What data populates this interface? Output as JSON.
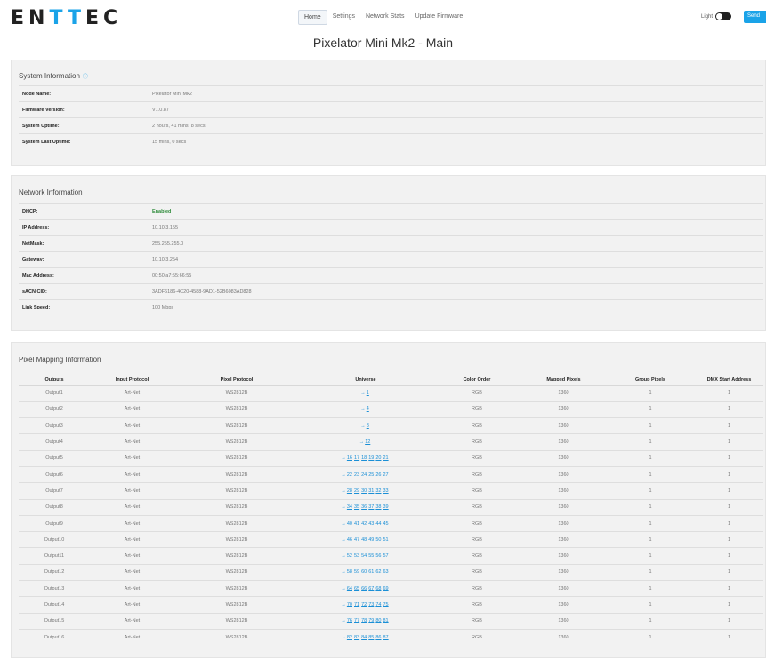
{
  "header": {
    "logo_parts": [
      "EN",
      "TT",
      "EC"
    ],
    "nav": [
      "Home",
      "Settings",
      "Network Stats",
      "Update Firmware"
    ],
    "theme_label": "Light",
    "send_label": "Send"
  },
  "page_title": "Pixelator Mini Mk2 - Main",
  "system": {
    "title": "System Information",
    "rows": [
      {
        "key": "Node Name:",
        "value": "Pixelator Mini Mk2"
      },
      {
        "key": "Firmware Version:",
        "value": "V1.0.87"
      },
      {
        "key": "System Uptime:",
        "value": "2 hours, 41 mins, 8 secs"
      },
      {
        "key": "System Last Uptime:",
        "value": "15 mins, 0 secs"
      }
    ]
  },
  "network": {
    "title": "Network Information",
    "rows": [
      {
        "key": "DHCP:",
        "value": "Enabled"
      },
      {
        "key": "IP Address:",
        "value": "10.10.3.155"
      },
      {
        "key": "NetMask:",
        "value": "255.255.255.0"
      },
      {
        "key": "Gateway:",
        "value": "10.10.3.254"
      },
      {
        "key": "Mac Address:",
        "value": "00:50:a7:55:66:55"
      },
      {
        "key": "sACN CID:",
        "value": "3ADF6186-4C20-4588-9AD1-52B6083AD828"
      },
      {
        "key": "Link Speed:",
        "value": "100 Mbps"
      }
    ]
  },
  "pixel_mapping": {
    "title": "Pixel Mapping Information",
    "columns": [
      "Outputs",
      "Input Protocol",
      "Pixel Protocol",
      "Universe",
      "Color Order",
      "Mapped Pixels",
      "Group Pixels",
      "DMX Start Address"
    ],
    "rows": [
      {
        "output": "Output1",
        "input": "Art-Net",
        "pixel": "WS2812B",
        "universes": [
          "1"
        ],
        "order": "RGB",
        "mapped": "1360",
        "group": "1",
        "dmx": "1"
      },
      {
        "output": "Output2",
        "input": "Art-Net",
        "pixel": "WS2812B",
        "universes": [
          "4"
        ],
        "order": "RGB",
        "mapped": "1360",
        "group": "1",
        "dmx": "1"
      },
      {
        "output": "Output3",
        "input": "Art-Net",
        "pixel": "WS2812B",
        "universes": [
          "8"
        ],
        "order": "RGB",
        "mapped": "1360",
        "group": "1",
        "dmx": "1"
      },
      {
        "output": "Output4",
        "input": "Art-Net",
        "pixel": "WS2812B",
        "universes": [
          "12"
        ],
        "order": "RGB",
        "mapped": "1360",
        "group": "1",
        "dmx": "1"
      },
      {
        "output": "Output5",
        "input": "Art-Net",
        "pixel": "WS2812B",
        "universes": [
          "16",
          "17",
          "18",
          "19",
          "20",
          "21"
        ],
        "order": "RGB",
        "mapped": "1360",
        "group": "1",
        "dmx": "1"
      },
      {
        "output": "Output6",
        "input": "Art-Net",
        "pixel": "WS2812B",
        "universes": [
          "22",
          "23",
          "24",
          "25",
          "26",
          "27"
        ],
        "order": "RGB",
        "mapped": "1360",
        "group": "1",
        "dmx": "1"
      },
      {
        "output": "Output7",
        "input": "Art-Net",
        "pixel": "WS2812B",
        "universes": [
          "28",
          "29",
          "30",
          "31",
          "32",
          "33"
        ],
        "order": "RGB",
        "mapped": "1360",
        "group": "1",
        "dmx": "1"
      },
      {
        "output": "Output8",
        "input": "Art-Net",
        "pixel": "WS2812B",
        "universes": [
          "34",
          "35",
          "36",
          "37",
          "38",
          "39"
        ],
        "order": "RGB",
        "mapped": "1360",
        "group": "1",
        "dmx": "1"
      },
      {
        "output": "Output9",
        "input": "Art-Net",
        "pixel": "WS2812B",
        "universes": [
          "40",
          "41",
          "42",
          "43",
          "44",
          "45"
        ],
        "order": "RGB",
        "mapped": "1360",
        "group": "1",
        "dmx": "1"
      },
      {
        "output": "Output10",
        "input": "Art-Net",
        "pixel": "WS2812B",
        "universes": [
          "46",
          "47",
          "48",
          "49",
          "50",
          "51"
        ],
        "order": "RGB",
        "mapped": "1360",
        "group": "1",
        "dmx": "1"
      },
      {
        "output": "Output11",
        "input": "Art-Net",
        "pixel": "WS2812B",
        "universes": [
          "52",
          "53",
          "54",
          "55",
          "56",
          "57"
        ],
        "order": "RGB",
        "mapped": "1360",
        "group": "1",
        "dmx": "1"
      },
      {
        "output": "Output12",
        "input": "Art-Net",
        "pixel": "WS2812B",
        "universes": [
          "58",
          "59",
          "60",
          "61",
          "62",
          "63"
        ],
        "order": "RGB",
        "mapped": "1360",
        "group": "1",
        "dmx": "1"
      },
      {
        "output": "Output13",
        "input": "Art-Net",
        "pixel": "WS2812B",
        "universes": [
          "64",
          "65",
          "66",
          "67",
          "68",
          "69"
        ],
        "order": "RGB",
        "mapped": "1360",
        "group": "1",
        "dmx": "1"
      },
      {
        "output": "Output14",
        "input": "Art-Net",
        "pixel": "WS2812B",
        "universes": [
          "70",
          "71",
          "72",
          "73",
          "74",
          "75"
        ],
        "order": "RGB",
        "mapped": "1360",
        "group": "1",
        "dmx": "1"
      },
      {
        "output": "Output15",
        "input": "Art-Net",
        "pixel": "WS2812B",
        "universes": [
          "76",
          "77",
          "78",
          "79",
          "80",
          "81"
        ],
        "order": "RGB",
        "mapped": "1360",
        "group": "1",
        "dmx": "1"
      },
      {
        "output": "Output16",
        "input": "Art-Net",
        "pixel": "WS2812B",
        "universes": [
          "82",
          "83",
          "84",
          "85",
          "86",
          "87"
        ],
        "order": "RGB",
        "mapped": "1360",
        "group": "1",
        "dmx": "1"
      }
    ]
  },
  "colors": {
    "accent": "#1aa3e8",
    "enabled": "#2e8b3a",
    "link": "#1a8fd6"
  },
  "icons": {
    "info": "info-icon",
    "universe_arrow": "arrow-right-icon",
    "theme_toggle": "toggle-icon"
  }
}
